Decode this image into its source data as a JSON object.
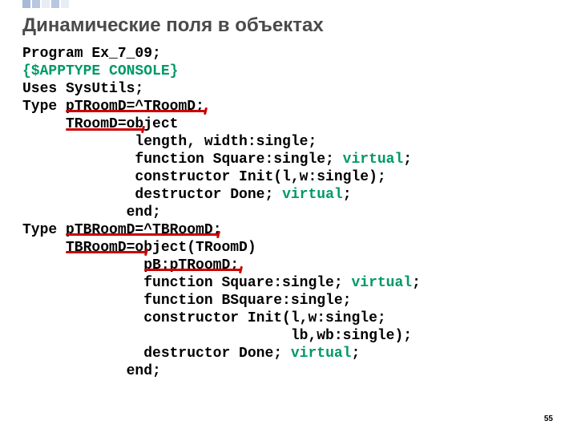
{
  "title": "Динамические поля в объектах",
  "page_number": "55",
  "code": {
    "l1": "Program Ex_7_09;",
    "l2": "{$APPTYPE CONSOLE}",
    "l3": "Uses SysUtils;",
    "l4a": "Type ",
    "l4b": "pTRoomD=^TRoomD;",
    "l5": "     TRoomD=object",
    "l6": "             length, width:single;",
    "l7a": "             function Square:single; ",
    "l7b": "virtual",
    "l7c": ";",
    "l8": "             constructor Init(l,w:single);",
    "l9a": "             destructor Done; ",
    "l9b": "virtual",
    "l9c": ";",
    "l10": "            end;",
    "l11a": "Type ",
    "l11b": "pTBRoomD=^TBRoomD;",
    "l12": "     TBRoomD=object(TRoomD)",
    "l13": "              pB:pTRoomD;",
    "l14a": "              function Square:single; ",
    "l14b": "virtual",
    "l14c": ";",
    "l15": "              function BSquare:single;",
    "l16": "              constructor Init(l,w:single;",
    "l17": "                               lb,wb:single);",
    "l18a": "              destructor Done; ",
    "l18b": "virtual",
    "l18c": ";",
    "l19": "            end;"
  }
}
